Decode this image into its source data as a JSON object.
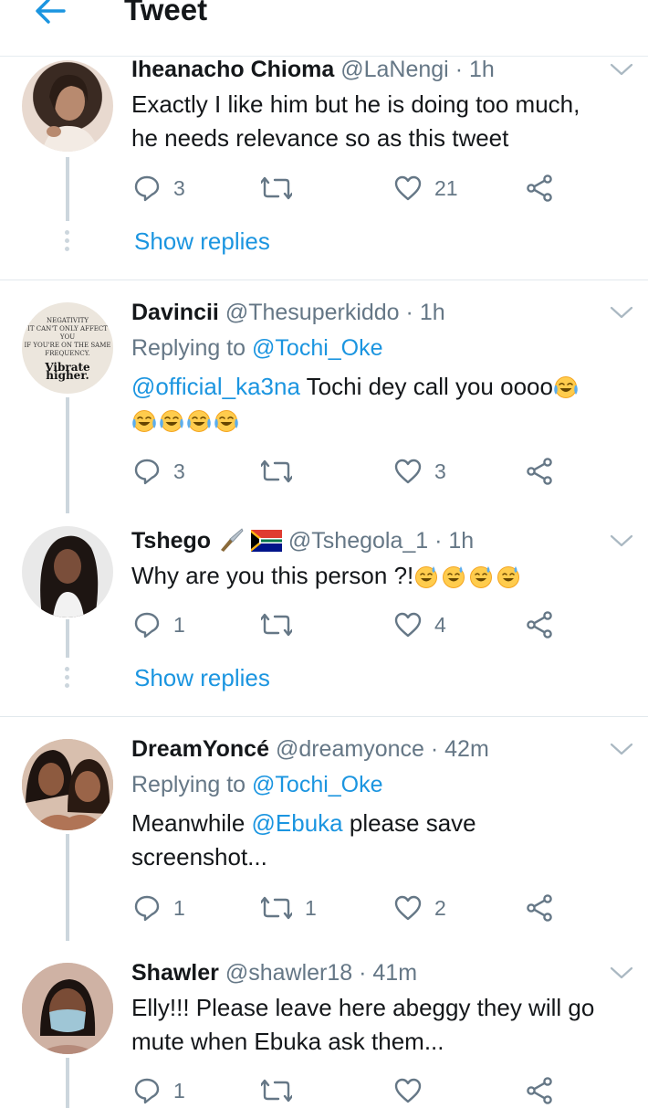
{
  "header": {
    "title": "Tweet",
    "back_icon": "arrow-left-icon"
  },
  "tweets": [
    {
      "name": "Iheanacho Chioma",
      "handle": "@LaNengi",
      "sep": "·",
      "time": "1h",
      "text_lines": [
        "Exactly I like him but he is doing too much,",
        "he needs relevance so as this tweet"
      ],
      "reply_count": "3",
      "retweet_count": "",
      "like_count": "21",
      "show_replies": "Show replies"
    },
    {
      "name": "Davincii",
      "handle": "@Thesuperkiddo",
      "sep": "·",
      "time": "1h",
      "replying_prefix": "Replying to",
      "replying_handle": "@Tochi_Oke",
      "mention": "@official_ka3na",
      "text": " Tochi dey call you oooo",
      "avatar_text": [
        "NEGATIVITY",
        "IT CAN'T ONLY AFFECT YOU",
        "IF YOU'RE ON THE SAME",
        "FREQUENCY.",
        "Vibrate higher."
      ],
      "reply_count": "3",
      "retweet_count": "",
      "like_count": "3"
    },
    {
      "name": "Tshego",
      "handle": "@Tshegola_1",
      "sep": "·",
      "time": "1h",
      "text": "Why are you this person ?!",
      "reply_count": "1",
      "retweet_count": "",
      "like_count": "4",
      "show_replies": "Show replies"
    },
    {
      "name": "DreamYoncé",
      "handle": "@dreamyonce",
      "sep": "·",
      "time": "42m",
      "replying_prefix": "Replying to",
      "replying_handle": "@Tochi_Oke",
      "text_pre": "Meanwhile ",
      "mention": "@Ebuka",
      "text_post": " please save",
      "text_line2": "screenshot...",
      "reply_count": "1",
      "retweet_count": "1",
      "like_count": "2"
    },
    {
      "name": "Shawler",
      "handle": "@shawler18",
      "sep": "·",
      "time": "41m",
      "text_lines": [
        "Elly!!! Please leave here abeggy they will go",
        "mute when Ebuka ask them..."
      ],
      "reply_count": "1",
      "retweet_count": "",
      "like_count": ""
    }
  ],
  "colors": {
    "link": "#1b95e0",
    "muted": "#657786",
    "text": "#14171a",
    "thread": "#ccd6dd"
  }
}
